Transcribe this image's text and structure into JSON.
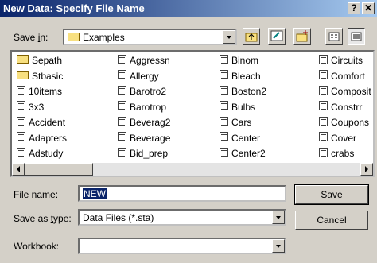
{
  "window": {
    "title": "New Data: Specify File Name",
    "help_label": "?",
    "close_label": "✕"
  },
  "savein": {
    "label_prefix": "Save ",
    "label_underline": "i",
    "label_suffix": "n:",
    "value": "Examples"
  },
  "toolbar": {
    "icons": [
      "up-folder-icon",
      "desktop-icon",
      "new-folder-icon",
      "list-view-icon",
      "details-view-icon"
    ]
  },
  "files": [
    {
      "name": "Sepath",
      "type": "folder"
    },
    {
      "name": "Stbasic",
      "type": "folder"
    },
    {
      "name": "10items",
      "type": "file"
    },
    {
      "name": "3x3",
      "type": "file"
    },
    {
      "name": "Accident",
      "type": "file"
    },
    {
      "name": "Adapters",
      "type": "file"
    },
    {
      "name": "Adstudy",
      "type": "file"
    },
    {
      "name": "Aggressn",
      "type": "file"
    },
    {
      "name": "Allergy",
      "type": "file"
    },
    {
      "name": "Barotro2",
      "type": "file"
    },
    {
      "name": "Barotrop",
      "type": "file"
    },
    {
      "name": "Beverag2",
      "type": "file"
    },
    {
      "name": "Beverage",
      "type": "file"
    },
    {
      "name": "Bid_prep",
      "type": "file"
    },
    {
      "name": "Binom",
      "type": "file"
    },
    {
      "name": "Bleach",
      "type": "file"
    },
    {
      "name": "Boston2",
      "type": "file"
    },
    {
      "name": "Bulbs",
      "type": "file"
    },
    {
      "name": "Cars",
      "type": "file"
    },
    {
      "name": "Center",
      "type": "file"
    },
    {
      "name": "Center2",
      "type": "file"
    },
    {
      "name": "Circuits",
      "type": "file"
    },
    {
      "name": "Comfort",
      "type": "file"
    },
    {
      "name": "Composit",
      "type": "file"
    },
    {
      "name": "Constrr",
      "type": "file"
    },
    {
      "name": "Coupons",
      "type": "file"
    },
    {
      "name": "Cover",
      "type": "file"
    },
    {
      "name": "crabs",
      "type": "file"
    }
  ],
  "filename": {
    "label_prefix": "File ",
    "label_underline": "n",
    "label_suffix": "ame:",
    "value": "NEW"
  },
  "savetype": {
    "label_prefix": "Save as ",
    "label_underline": "t",
    "label_suffix": "ype:",
    "value": "Data Files (*.sta)"
  },
  "workbook": {
    "label": "Workbook:",
    "value": ""
  },
  "buttons": {
    "save_underline": "S",
    "save_rest": "ave",
    "cancel": "Cancel"
  },
  "scrollbar": {
    "left_arrow": "◀",
    "right_arrow": "▶"
  }
}
